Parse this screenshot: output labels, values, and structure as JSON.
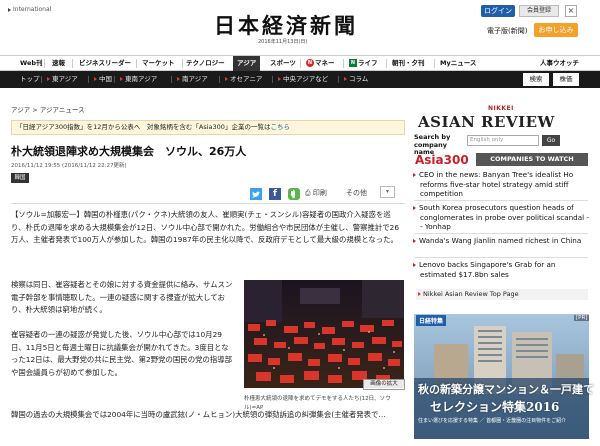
{
  "header": {
    "international": "International",
    "logo": "日本経済新聞",
    "date": "2016年11月13日(日)",
    "login": "ログイン",
    "member": "会員登録",
    "close": "×",
    "edition": "電子版(新聞)",
    "apply": "お申し込み"
  },
  "nav1": {
    "items": [
      "Web刊",
      "速報",
      "ビジネスリーダー",
      "マーケット",
      "テクノロジー",
      "アジア",
      "スポーツ",
      "マネー",
      "ライフ",
      "朝刊・夕刊",
      "Myニュース",
      "人事ウオッチ"
    ],
    "money_badge": "N",
    "life_badge": "N"
  },
  "nav2": {
    "items": [
      "トップ",
      "東アジア",
      "中国",
      "東南アジア",
      "南アジア",
      "オセアニア",
      "中央アジアなど",
      "コラム"
    ],
    "search": "検索",
    "stock": "株価"
  },
  "article": {
    "breadcrumb": "アジア > アジアニュース",
    "notice_text": "「日経アジア300指数」を12月から公表へ　対象銘柄を含む「Asia300」企業の一覧は",
    "notice_link": "こちら",
    "title": "朴大統領退陣求め大規模集会　ソウル、26万人",
    "timestamp": "2016/11/12 19:55 (2016/11/12 22:27更新)",
    "tag": "韓国",
    "share_print": "印刷",
    "share_other": "その他",
    "share_menu": "▾",
    "fb_glyph": "f",
    "para1": "【ソウル=加藤宏一】韓国の朴槿恵(パク・クネ)大統領の友人、崔順実(チェ・スンシル)容疑者の国政介入疑惑を巡り、朴氏の退陣を求める大規模集会が12日、ソウル中心部で開かれた。労働組合や市民団体が主催し、警察推計で26万人、主催者発表で100万人が参加した。韓国の1987年の民主化以降で、反政府デモとして最大級の規模となった。",
    "para2": "検察は同日、崔容疑者とその娘に対する資金提供に絡み、サムスン電子幹部を事情聴取した。一連の疑惑に関する捜査が拡大しており、朴大統領は窮地が続く。",
    "para3": "崔容疑者の一連の疑惑が発覚した後、ソウル中心部では10月29日、11月5日と毎週土曜日に抗議集会が開かれてきた。3度目となった12日は、最大野党の共に民主党、第2野党の国民の党の指導部や国会議員らが初めて参加した。",
    "para4": "韓国の過去の大規模集会では2004年に当時の盧武鉉(ノ・ムヒョン)大統領の弾劾訴追の糾弾集会(主催者発表で…",
    "photo_enlarge": "画像の拡大",
    "photo_caption": "朴槿恵大統領の退陣を求めてデモをする人たち(12日、ソウル)=AP"
  },
  "sidebar": {
    "nikkei": "NIKKEI",
    "title": "ASIAN REVIEW",
    "search_label": "Search by company name",
    "search_placeholder": "English only",
    "go": "Go",
    "asia300": "Asia",
    "asia300_num": "300",
    "companies_btn": "COMPANIES TO WATCH",
    "news": [
      "CEO in the news: Banyan Tree's idealist Ho reforms five-star hotel strategy amid stiff competition",
      "South Korea prosecutors question heads of conglomerates in probe over political scandal -- Yonhap",
      "Wanda's Wang Jianlin named richest in China",
      "Lenovo backs Singapore's Grab for an estimated $17.8bn sales"
    ],
    "review_link": "Nikkei Asian Review Top Page"
  },
  "ad": {
    "logo": "日経特集",
    "pr": "[PR]",
    "line1": "秋の新築分譲マンション＆一戸建て",
    "line2": "セレクション特集2016",
    "small": "住まい選びを応援する特集 ／ 首都圏・近畿圏の注目物件をご紹介"
  }
}
